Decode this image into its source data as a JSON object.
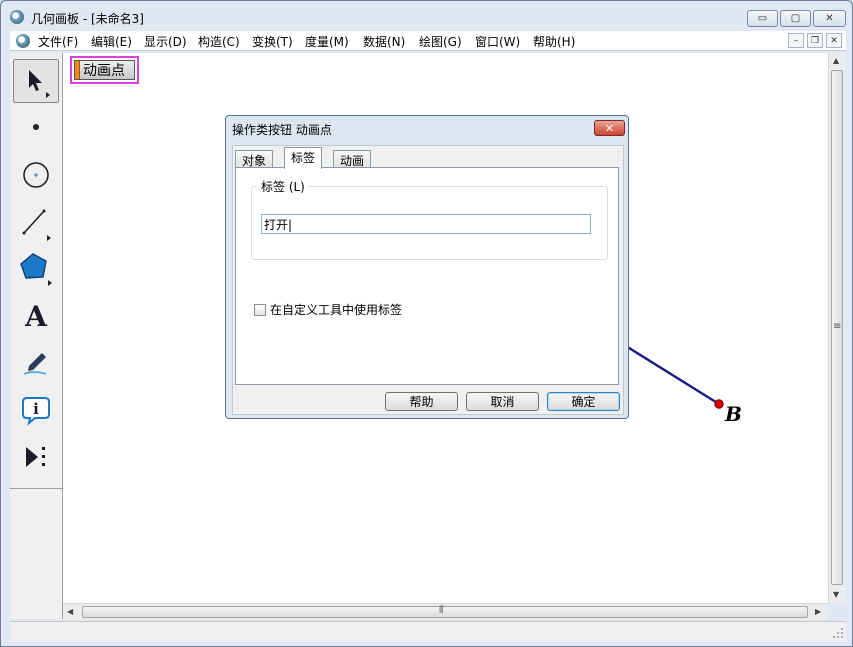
{
  "window": {
    "title": "几何画板 - [未命名3]",
    "controls": {
      "minimize": "▭",
      "maximize": "▢",
      "close": "✕"
    }
  },
  "menu": {
    "items": [
      {
        "label": "文件(F)"
      },
      {
        "label": "编辑(E)"
      },
      {
        "label": "显示(D)"
      },
      {
        "label": "构造(C)"
      },
      {
        "label": "变换(T)"
      },
      {
        "label": "度量(M)"
      },
      {
        "label": "数据(N)"
      },
      {
        "label": "绘图(G)"
      },
      {
        "label": "窗口(W)"
      },
      {
        "label": "帮助(H)"
      }
    ],
    "mdi_controls": {
      "minimize": "–",
      "restore": "❐",
      "close": "✕"
    }
  },
  "toolbox": {
    "tools": [
      "arrow-select-tool",
      "point-tool",
      "compass-tool",
      "straightedge-tool",
      "polygon-tool",
      "text-tool",
      "marker-tool",
      "information-tool",
      "custom-tool"
    ],
    "text_tool_glyph": "A",
    "info_tool_glyph": "i"
  },
  "canvas": {
    "action_button": {
      "label": "动画点",
      "stripe_color": "#f08a1c",
      "border_color": "#e040e0"
    },
    "point_b": {
      "label": "B",
      "color": "#dd0000"
    },
    "segment_color": "#1a1a80"
  },
  "dialog": {
    "title": "操作类按钮 动画点",
    "close_glyph": "✕",
    "tabs": [
      {
        "label": "对象",
        "active": false
      },
      {
        "label": "标签",
        "active": true
      },
      {
        "label": "动画",
        "active": false
      }
    ],
    "label_group": {
      "legend": "标签 (L)",
      "value": "打开|",
      "placeholder": ""
    },
    "checkbox_label": "在自定义工具中使用标签",
    "checkbox_checked": false,
    "buttons": {
      "help": "帮助",
      "cancel": "取消",
      "ok": "确定"
    }
  },
  "scrollbars": {
    "h_grip": "⦀",
    "v_grip": "≡"
  }
}
